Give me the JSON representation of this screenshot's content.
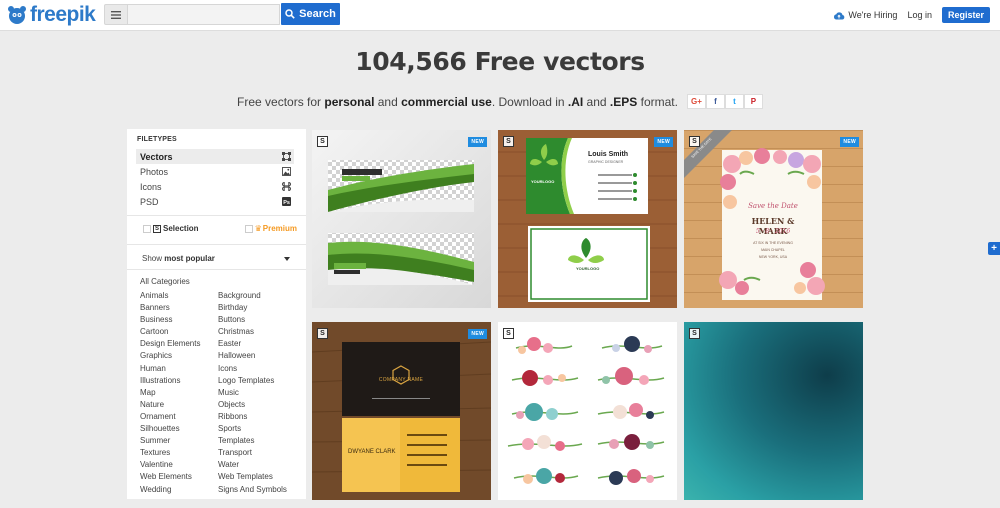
{
  "brand": {
    "name": "freepik",
    "color": "#2d7ac9"
  },
  "header": {
    "search_placeholder": "",
    "search_label": "Search",
    "hiring_label": "We're Hiring",
    "login_label": "Log in",
    "register_label": "Register"
  },
  "hero": {
    "title": "104,566 Free vectors",
    "sub_prefix": "Free vectors for ",
    "sub_personal": "personal",
    "sub_and": " and ",
    "sub_commercial": "commercial use",
    "sub_mid": ". Download in ",
    "sub_ai": ".AI",
    "sub_and2": " and ",
    "sub_eps": ".EPS",
    "sub_suffix": " format.",
    "social": [
      {
        "label": "G+",
        "color": "#dd4b39",
        "icon": "google-plus-icon"
      },
      {
        "label": "f",
        "color": "#3b5998",
        "icon": "facebook-icon"
      },
      {
        "label": "t",
        "color": "#1da1f2",
        "icon": "twitter-icon"
      },
      {
        "label": "P",
        "color": "#cb2027",
        "icon": "pinterest-icon"
      }
    ]
  },
  "sidebar": {
    "filetypes_title": "FILETYPES",
    "filetypes": [
      {
        "label": "Vectors",
        "icon": "vector-icon",
        "active": true
      },
      {
        "label": "Photos",
        "icon": "photo-icon",
        "active": false
      },
      {
        "label": "Icons",
        "icon": "icons-icon",
        "active": false
      },
      {
        "label": "PSD",
        "icon": "psd-icon",
        "active": false
      }
    ],
    "selection_label": "Selection",
    "premium_label": "Premium",
    "show_prefix": "Show ",
    "show_value": "most popular",
    "all_categories": "All Categories",
    "categories_left": [
      "Animals",
      "Banners",
      "Business",
      "Cartoon",
      "Design Elements",
      "Graphics",
      "Human",
      "Illustrations",
      "Map",
      "Nature",
      "Ornament",
      "Silhouettes",
      "Summer",
      "Textures",
      "Valentine",
      "Web Elements",
      "Wedding"
    ],
    "categories_right": [
      "Background",
      "Birthday",
      "Buttons",
      "Christmas",
      "Easter",
      "Halloween",
      "Icons",
      "Logo Templates",
      "Music",
      "Objects",
      "Ribbons",
      "Sports",
      "Templates",
      "Transport",
      "Water",
      "Web Templates",
      "Signs And Symbols"
    ]
  },
  "tiles": [
    {
      "name": "green-banners",
      "new_label": "NEW",
      "s_label": "S",
      "banner_text_1": "YOUR Amazing",
      "banner_text_2": "BUSINESS",
      "banner_text_3": "YOUR BUSINESS"
    },
    {
      "name": "green-business-card",
      "new_label": "NEW",
      "s_label": "S",
      "person": "Louis Smith",
      "role": "GRAPHIC DESIGNER",
      "logo_text": "YOURLOGO"
    },
    {
      "name": "floral-wedding-invitation",
      "new_label": "NEW",
      "s_label": "S",
      "ribbon": "SAVE THE DATE",
      "line1": "Save the Date",
      "line2": "HELEN & MARK",
      "line3": "5 · 8 · 2016",
      "line4": "AT SIX IN THE EVENING",
      "line5": "MAIN CHAPEL",
      "line6": "NEW YORK, USA"
    },
    {
      "name": "dark-gold-business-card",
      "new_label": "NEW",
      "s_label": "S",
      "company": "COMPANY NAME",
      "person": "DWYANE CLARK"
    },
    {
      "name": "watercolor-flowers",
      "s_label": "S"
    },
    {
      "name": "teal-blur-background",
      "s_label": "S"
    }
  ]
}
